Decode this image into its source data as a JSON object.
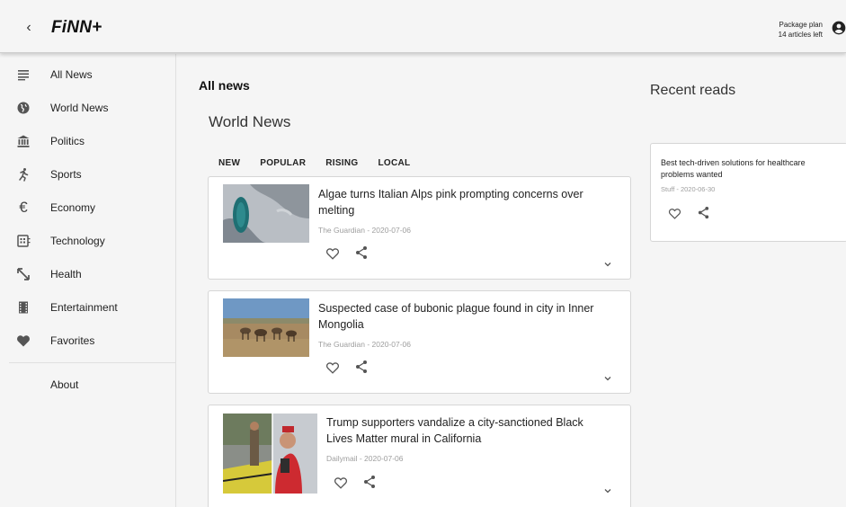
{
  "header": {
    "back_label": "‹",
    "logo": "FiNN+",
    "plan_line1": "Package plan",
    "plan_line2": "14 articles left"
  },
  "sidebar": {
    "items": [
      {
        "label": "All News",
        "icon": "list-icon"
      },
      {
        "label": "World News",
        "icon": "globe-icon"
      },
      {
        "label": "Politics",
        "icon": "bank-icon"
      },
      {
        "label": "Sports",
        "icon": "runner-icon"
      },
      {
        "label": "Economy",
        "icon": "euro-icon"
      },
      {
        "label": "Technology",
        "icon": "chip-icon"
      },
      {
        "label": "Health",
        "icon": "arrows-icon"
      },
      {
        "label": "Entertainment",
        "icon": "film-icon"
      },
      {
        "label": "Favorites",
        "icon": "heart-icon"
      }
    ],
    "about": "About"
  },
  "main": {
    "title": "All news",
    "section": "World News",
    "tabs": [
      "NEW",
      "POPULAR",
      "RISING",
      "LOCAL"
    ],
    "articles": [
      {
        "title": "Algae turns Italian Alps pink prompting concerns over melting",
        "meta": "The Guardian - 2020-07-06"
      },
      {
        "title": "Suspected case of bubonic plague found in city in Inner Mongolia",
        "meta": "The Guardian - 2020-07-06"
      },
      {
        "title": "Trump supporters vandalize a city-sanctioned Black Lives Matter mural in California",
        "meta": "Dailymail - 2020-07-06"
      }
    ]
  },
  "recent": {
    "title": "Recent reads",
    "items": [
      {
        "title": "Best tech-driven solutions for healthcare problems wanted",
        "meta": "Stuff - 2020-06-30"
      }
    ]
  },
  "colors": {
    "background": "#f5f5f5",
    "card": "#ffffff",
    "meta": "#9e9e9e"
  }
}
